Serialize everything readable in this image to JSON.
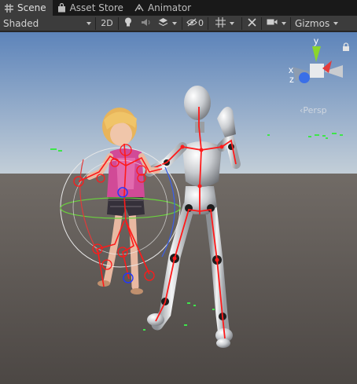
{
  "tabs": [
    {
      "label": "Scene",
      "icon": "scene-grid-icon",
      "active": true
    },
    {
      "label": "Asset Store",
      "icon": "shopping-bag-icon",
      "active": false
    },
    {
      "label": "Animator",
      "icon": "animator-icon",
      "active": false
    }
  ],
  "toolbar": {
    "shading_mode": "Shaded",
    "mode_2d": "2D",
    "hidden_count": "0",
    "gizmos_label": "Gizmos"
  },
  "viewport": {
    "projection_label": "Persp",
    "gizmo_axes": {
      "x": "x",
      "y": "y",
      "z": "z"
    },
    "colors": {
      "sky_top": "#5d84ba",
      "sky_horizon": "#c4cfd8",
      "ground": "#55504d",
      "bone": "#ff1a1a",
      "axis_x": "#e33b3b",
      "axis_y": "#8bd62b",
      "axis_z": "#3a6fe8"
    }
  }
}
